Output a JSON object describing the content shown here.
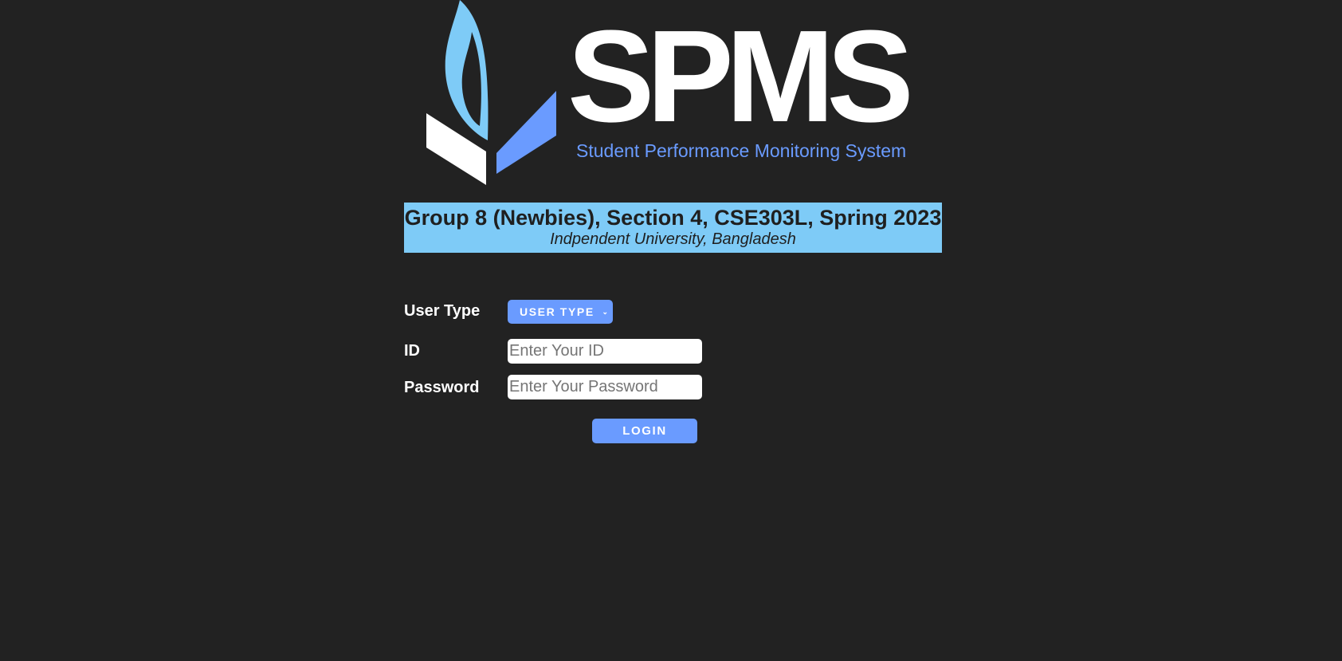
{
  "logo": {
    "wordmark": "SPMS",
    "tagline": "Student Performance Monitoring System"
  },
  "banner": {
    "title": "Group 8 (Newbies), Section 4, CSE303L, Spring 2023",
    "subtitle": "Indpendent University, Bangladesh"
  },
  "form": {
    "user_type_label": "User Type",
    "user_type_selected": "USER TYPE",
    "id_label": "ID",
    "id_placeholder": "Enter Your ID",
    "password_label": "Password",
    "password_placeholder": "Enter Your Password",
    "login_label": "LOGIN"
  },
  "colors": {
    "background": "#222222",
    "accent": "#6a9bff",
    "banner": "#7ecbf7",
    "flame": "#7ecbf7"
  }
}
